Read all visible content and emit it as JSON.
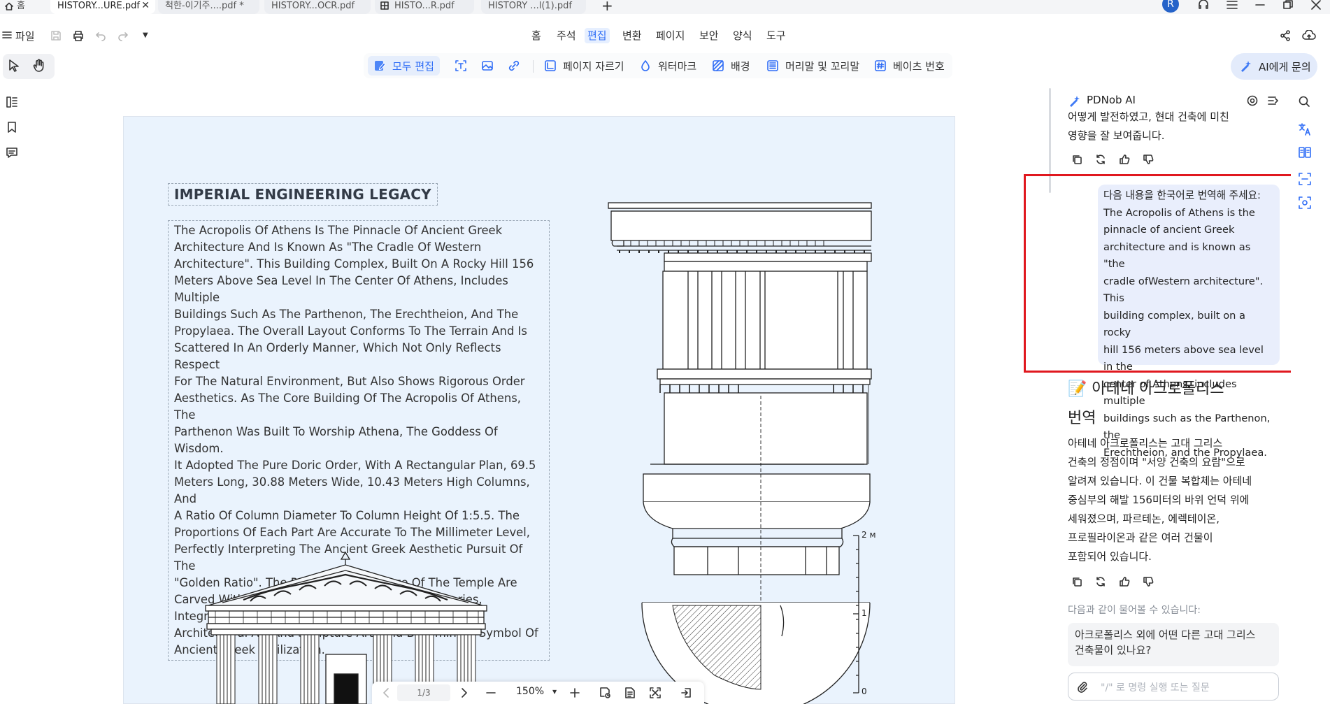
{
  "tabs": [
    {
      "label": "홈"
    },
    {
      "label": "HISTORY...URE.pdf",
      "active": true
    },
    {
      "label": "척한-이기주....pdf *"
    },
    {
      "label": "HISTORY...OCR.pdf"
    },
    {
      "label": "HISTO...R.pdf"
    },
    {
      "label": "HISTORY ...l(1).pdf"
    }
  ],
  "user": {
    "avatar_letter": "R"
  },
  "file_menu": {
    "label": "파일"
  },
  "menu": [
    "홈",
    "주석",
    "편집",
    "변환",
    "페이지",
    "보안",
    "양식",
    "도구"
  ],
  "active_menu": "편집",
  "toolbar": {
    "edit_all": "모두 편집",
    "crop_pages": "페이지 자르기",
    "watermark": "워터마크",
    "background": "배경",
    "header_footer": "머리말 및 꼬리말",
    "bates": "베이츠 번호",
    "ask_ai": "AI에게 문의"
  },
  "document": {
    "title": "IMPERIAL ENGINEERING LEGACY",
    "body_lines": [
      "The Acropolis Of Athens Is The Pinnacle Of Ancient Greek",
      "Architecture And Is Known As \"The Cradle Of Western",
      "Architecture\". This Building Complex, Built On A Rocky Hill 156",
      "Meters Above Sea Level In The Center Of Athens, Includes Multiple",
      "Buildings Such As The Parthenon, The Erechtheion, And The",
      "Propylaea. The Overall Layout Conforms To The Terrain And Is",
      "Scattered In An Orderly Manner, Which Not Only Reflects Respect",
      "For The Natural Environment, But Also Shows Rigorous Order",
      "Aesthetics. As The Core Building Of The Acropolis Of Athens, The",
      "Parthenon Was Built To Worship Athena, The Goddess Of Wisdom.",
      "It Adopted The Pure Doric Order, With A Rectangular Plan, 69.5",
      "Meters Long, 30.88 Meters Wide, 10.43 Meters High Columns, And",
      "A Ratio Of Column Diameter To Column Height Of 1:5.5. The",
      "Proportions Of Each Part Are Accurate To The Millimeter Level,",
      "Perfectly Interpreting The Ancient Greek Aesthetic Pursuit Of The",
      "\"Golden Ratio\". The Pediment And Frieze Of The Temple Are",
      "Carved With Exquisite Reliefs Of Mythological Stories, Integrating",
      "Architectural Art And Sculpture Art, And Becoming A Symbol Of",
      "Ancient Greek Civilization."
    ],
    "scale_labels": [
      "2 м",
      "1",
      "0"
    ]
  },
  "bottom_nav": {
    "page": "1/3",
    "zoom": "150%"
  },
  "ai_panel": {
    "title": "PDNob AI",
    "prev_lines": [
      "어떻게 발전하였고, 현대 건축에 미친",
      "영향을 잘 보여줍니다."
    ],
    "user_message_lines": [
      "다음 내용을 한국어로 번역해 주세요:",
      "The Acropolis of Athens is the",
      "pinnacle of ancient Greek",
      "architecture and is known as \"the",
      "cradle ofWestern architecture\". This",
      "building complex, built on a rocky",
      "hill 156 meters above sea level in the",
      "center of Athens, includes multiple",
      "buildings such as the Parthenon, the",
      "Erechtheion, and the Propylaea."
    ],
    "answer_heading_line1": "📝 아테네 아크로폴리스",
    "answer_heading_line2": "번역",
    "answer_lines": [
      "아테네 아크로폴리스는 고대 그리스",
      "건축의 정점이며 \"서양 건축의 요람\"으로",
      "알려져 있습니다. 이 건물 복합체는 아테네",
      "중심부의 해발 156미터의 바위 언덕 위에",
      "세워졌으며, 파르테논, 에렉테이온,",
      "프로필라이온과 같은 여러 건물이",
      "포함되어 있습니다."
    ],
    "suggest_label": "다음과 같이 물어볼 수 있습니다:",
    "suggestion_lines": [
      "아크로폴리스 외에 어떤 다른 고대 그리스",
      "건축물이 있나요?"
    ],
    "input_placeholder": "\"/\" 로 명령 실행 또는 질문"
  }
}
